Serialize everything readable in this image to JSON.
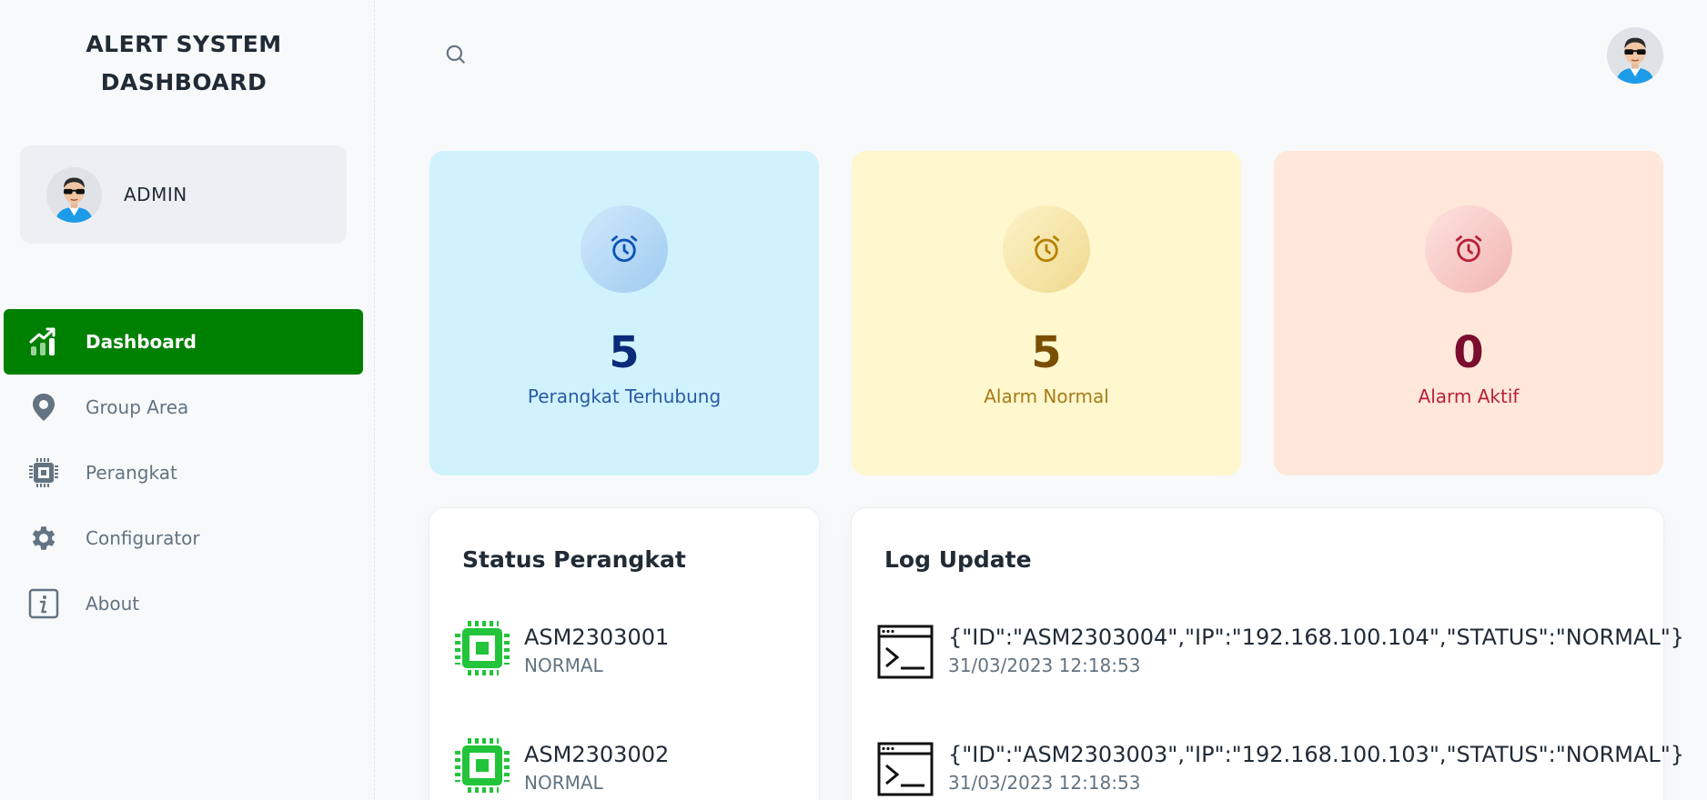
{
  "app": {
    "title_line1": "ALERT SYSTEM",
    "title_line2": "DASHBOARD"
  },
  "user": {
    "name": "ADMIN"
  },
  "nav": {
    "items": [
      {
        "label": "Dashboard",
        "icon": "chart-trend-icon",
        "active": true
      },
      {
        "label": "Group Area",
        "icon": "map-pin-icon"
      },
      {
        "label": "Perangkat",
        "icon": "chip-icon"
      },
      {
        "label": "Configurator",
        "icon": "gear-icon"
      },
      {
        "label": "About",
        "icon": "info-icon"
      }
    ]
  },
  "stats": [
    {
      "value": "5",
      "label": "Perangkat Terhubung",
      "icon": "alarm-clock-icon",
      "color": "#0c53b7"
    },
    {
      "value": "5",
      "label": "Alarm Normal",
      "icon": "alarm-clock-icon",
      "color": "#b78103"
    },
    {
      "value": "0",
      "label": "Alarm Aktif",
      "icon": "alarm-clock-icon",
      "color": "#b72136"
    }
  ],
  "status_panel": {
    "title": "Status Perangkat",
    "devices": [
      {
        "name": "ASM2303001",
        "status": "NORMAL"
      },
      {
        "name": "ASM2303002",
        "status": "NORMAL"
      }
    ]
  },
  "log_panel": {
    "title": "Log Update",
    "entries": [
      {
        "message": "{\"ID\":\"ASM2303004\",\"IP\":\"192.168.100.104\",\"STATUS\":\"NORMAL\"}",
        "time": "31/03/2023 12:18:53"
      },
      {
        "message": "{\"ID\":\"ASM2303003\",\"IP\":\"192.168.100.103\",\"STATUS\":\"NORMAL\"}",
        "time": "31/03/2023 12:18:53"
      }
    ]
  },
  "colors": {
    "active_nav": "#008000",
    "chip_green": "#22c43a"
  }
}
